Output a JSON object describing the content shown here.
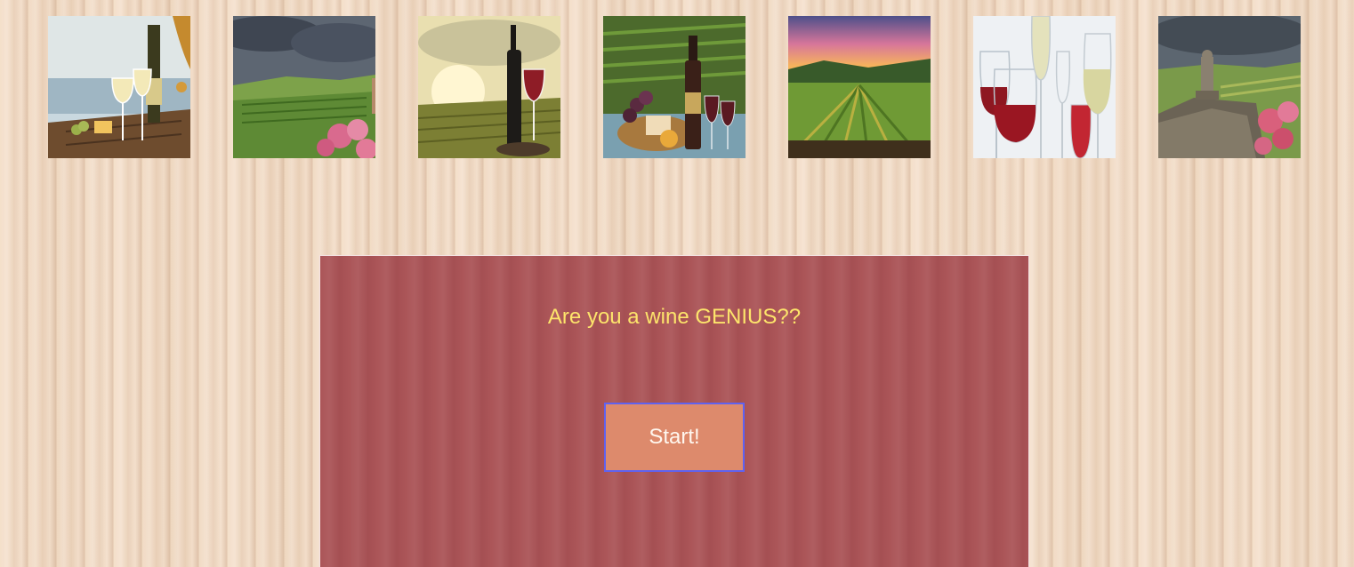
{
  "gallery": {
    "photos": [
      {
        "name": "white-wine-lake-photo",
        "palette": [
          "#b9cdd8",
          "#e7ecea",
          "#6e4c2e"
        ]
      },
      {
        "name": "vineyard-storm-photo",
        "palette": [
          "#56606d",
          "#6f9a45",
          "#d76a8e"
        ]
      },
      {
        "name": "sunset-red-wine-photo",
        "palette": [
          "#f0e6b5",
          "#8a8a3c",
          "#1d1b18"
        ]
      },
      {
        "name": "wine-cheese-vineyard-photo",
        "palette": [
          "#3c5a23",
          "#7a3b42",
          "#d6a04a"
        ]
      },
      {
        "name": "vineyard-sunset-photo",
        "palette": [
          "#6a5a8c",
          "#f3a65b",
          "#5c7a2e"
        ]
      },
      {
        "name": "wine-glasses-photo",
        "palette": [
          "#eef1f4",
          "#8e1721",
          "#d8d6a0"
        ]
      },
      {
        "name": "stone-terrace-photo",
        "palette": [
          "#5c6670",
          "#7a9a4a",
          "#d9607c"
        ]
      }
    ]
  },
  "quiz": {
    "title": "Are you a wine GENIUS??",
    "start_label": "Start!"
  },
  "colors": {
    "panel": "#ab5558",
    "title": "#fde46b",
    "button": "#dd8a6c",
    "button_border": "#5f62f0"
  }
}
